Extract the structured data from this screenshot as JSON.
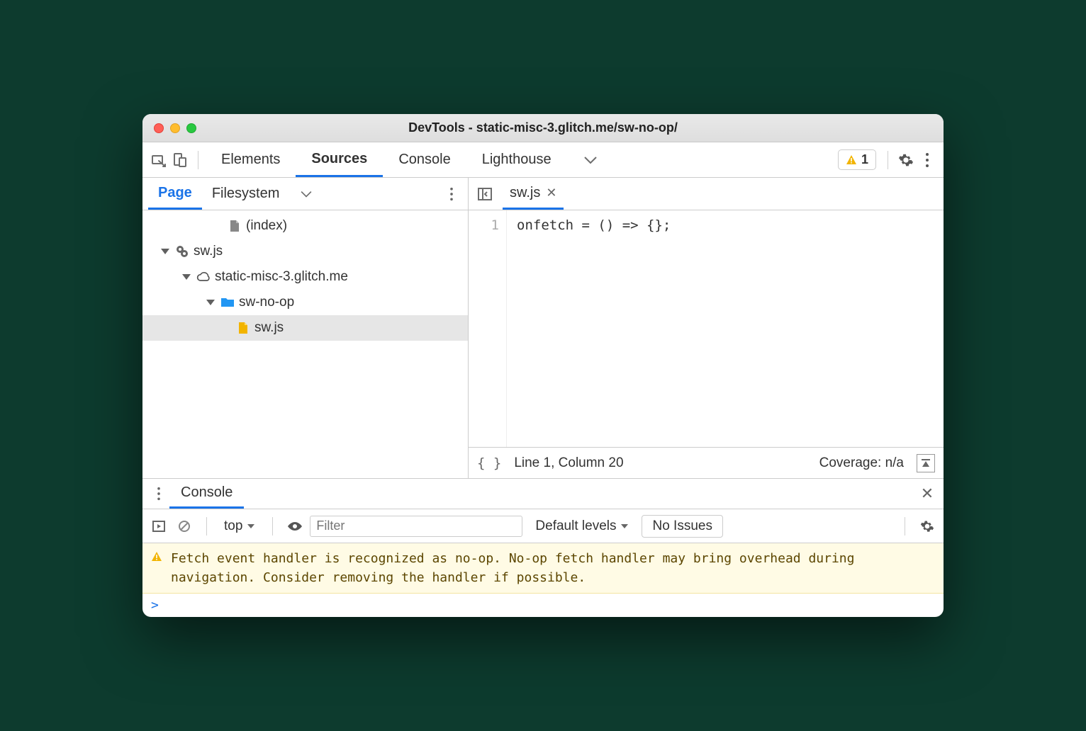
{
  "title": "DevTools - static-misc-3.glitch.me/sw-no-op/",
  "main_tabs": {
    "elements": "Elements",
    "sources": "Sources",
    "console": "Console",
    "lighthouse": "Lighthouse"
  },
  "warning_count": "1",
  "left_tabs": {
    "page": "Page",
    "filesystem": "Filesystem"
  },
  "tree": {
    "index": "(index)",
    "sw_root": "sw.js",
    "domain": "static-misc-3.glitch.me",
    "folder": "sw-no-op",
    "swjs": "sw.js"
  },
  "file_tab": {
    "name": "sw.js"
  },
  "gutter_line": "1",
  "code_line": "onfetch = () => {};",
  "status": {
    "braces": "{ }",
    "position": "Line 1, Column 20",
    "coverage": "Coverage: n/a"
  },
  "drawer": {
    "console_tab": "Console"
  },
  "console_toolbar": {
    "context": "top",
    "filter_placeholder": "Filter",
    "levels": "Default levels",
    "issues": "No Issues"
  },
  "warning_message": "Fetch event handler is recognized as no-op. No-op fetch handler may bring overhead during navigation. Consider removing the handler if possible.",
  "prompt": ">"
}
